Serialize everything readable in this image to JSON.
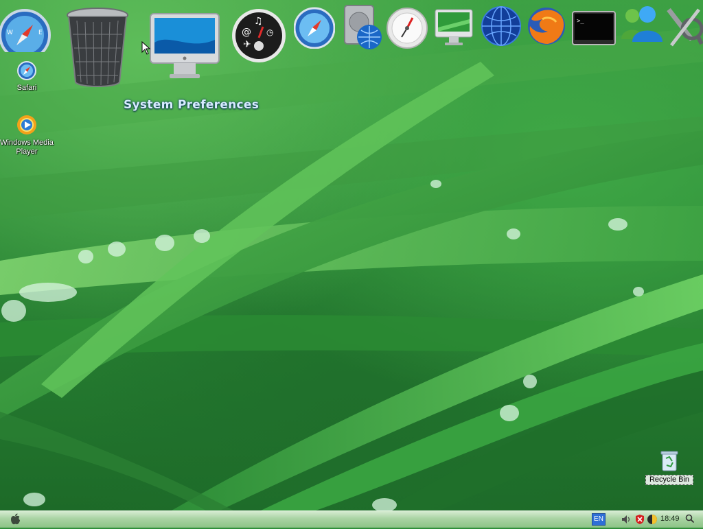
{
  "dock": {
    "hover_label": "System Preferences",
    "items": [
      {
        "name": "safari"
      },
      {
        "name": "trash"
      },
      {
        "name": "system-preferences"
      },
      {
        "name": "dashboard"
      },
      {
        "name": "safari-compass"
      },
      {
        "name": "network-disk"
      },
      {
        "name": "time-machine-compass"
      },
      {
        "name": "imac-display"
      },
      {
        "name": "network-globe"
      },
      {
        "name": "firefox"
      },
      {
        "name": "terminal"
      },
      {
        "name": "messenger"
      },
      {
        "name": "utilities"
      }
    ]
  },
  "desktop_icons": {
    "safari": {
      "label": "Safari"
    },
    "wmp": {
      "label": "Windows Media Player"
    },
    "recycle": {
      "label": "Recycle Bin"
    }
  },
  "taskbar": {
    "language": "EN",
    "clock": "18:49"
  }
}
